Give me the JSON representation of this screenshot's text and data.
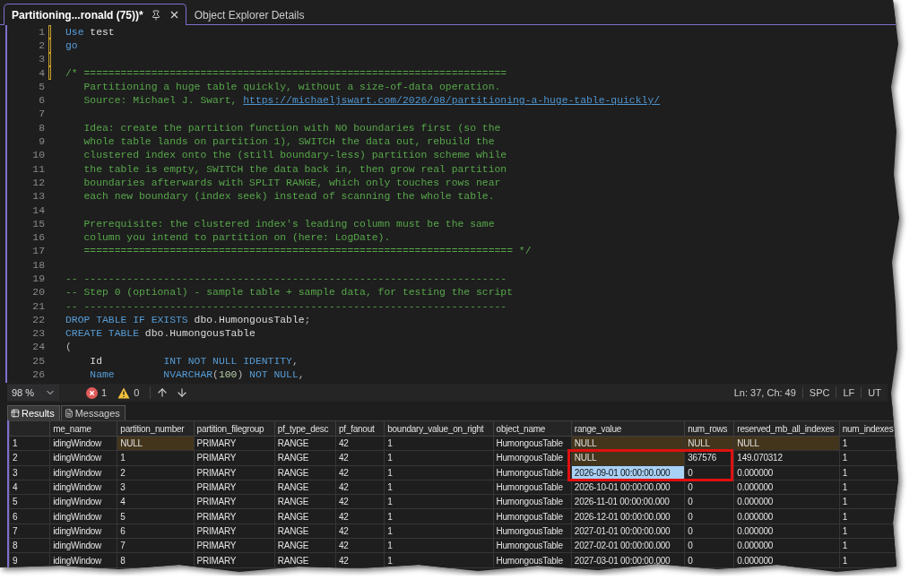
{
  "tabs": [
    {
      "label": "Partitioning...ronald (75))*",
      "selected": true
    },
    {
      "label": "Object Explorer Details",
      "selected": false
    }
  ],
  "editor": {
    "lines": [
      {
        "number": "1",
        "changed": true,
        "tokens": [
          {
            "kind": "keyword",
            "text": "Use"
          },
          {
            "kind": "plain",
            "text": " test"
          }
        ]
      },
      {
        "number": "2",
        "changed": true,
        "tokens": [
          {
            "kind": "keyword",
            "text": "go"
          }
        ]
      },
      {
        "number": "3",
        "changed": true
      },
      {
        "number": "4",
        "changed": true,
        "tokens": [
          {
            "kind": "comment",
            "text": "/* ====================================================================="
          }
        ]
      },
      {
        "number": "5",
        "changed": false,
        "tokens": [
          {
            "kind": "comment",
            "text": "   Partitioning a huge table quickly, without a size-of-data operation."
          }
        ]
      },
      {
        "number": "6",
        "changed": false,
        "tokens": [
          {
            "kind": "comment",
            "text": "   Source: Michael J. Swart, "
          },
          {
            "kind": "link",
            "text": "https://michaeljswart.com/2026/08/partitioning-a-huge-table-quickly/"
          }
        ]
      },
      {
        "number": "7",
        "changed": false
      },
      {
        "number": "8",
        "changed": false,
        "tokens": [
          {
            "kind": "comment",
            "text": "   Idea: create the partition function with NO boundaries first (so the"
          }
        ]
      },
      {
        "number": "9",
        "changed": false,
        "tokens": [
          {
            "kind": "comment",
            "text": "   whole table lands on partition 1), SWITCH the data out, rebuild the"
          }
        ]
      },
      {
        "number": "10",
        "changed": false,
        "tokens": [
          {
            "kind": "comment",
            "text": "   clustered index onto the (still boundary-less) partition scheme while"
          }
        ]
      },
      {
        "number": "11",
        "changed": false,
        "tokens": [
          {
            "kind": "comment",
            "text": "   the table is empty, SWITCH the data back in, then grow real partition"
          }
        ]
      },
      {
        "number": "12",
        "changed": false,
        "tokens": [
          {
            "kind": "comment",
            "text": "   boundaries afterwards with SPLIT RANGE, which only touches rows near"
          }
        ]
      },
      {
        "number": "13",
        "changed": false,
        "tokens": [
          {
            "kind": "comment",
            "text": "   each new boundary (index seek) instead of scanning the whole table."
          }
        ]
      },
      {
        "number": "14",
        "changed": false
      },
      {
        "number": "15",
        "changed": false,
        "tokens": [
          {
            "kind": "comment",
            "text": "   Prerequisite: the clustered index's leading column must be the same"
          }
        ]
      },
      {
        "number": "16",
        "changed": false,
        "tokens": [
          {
            "kind": "comment",
            "text": "   column you intend to partition on (here: LogDate)."
          }
        ]
      },
      {
        "number": "17",
        "changed": false,
        "tokens": [
          {
            "kind": "comment",
            "text": "   ====================================================================== */"
          }
        ]
      },
      {
        "number": "18",
        "changed": false
      },
      {
        "number": "19",
        "changed": false,
        "tokens": [
          {
            "kind": "comment",
            "text": "-- ---------------------------------------------------------------------"
          }
        ]
      },
      {
        "number": "20",
        "changed": false,
        "tokens": [
          {
            "kind": "comment",
            "text": "-- Step 0 (optional) - sample table + sample data, for testing the script"
          }
        ]
      },
      {
        "number": "21",
        "changed": false,
        "tokens": [
          {
            "kind": "comment",
            "text": "-- ---------------------------------------------------------------------"
          }
        ]
      },
      {
        "number": "22",
        "changed": false,
        "tokens": [
          {
            "kind": "keyword",
            "text": "DROP TABLE IF EXISTS"
          },
          {
            "kind": "plain",
            "text": " dbo"
          },
          {
            "kind": "punct",
            "text": "."
          },
          {
            "kind": "plain",
            "text": "HumongousTable"
          },
          {
            "kind": "punct",
            "text": ";"
          }
        ]
      },
      {
        "number": "23",
        "changed": false,
        "tokens": [
          {
            "kind": "keyword",
            "text": "CREATE TABLE"
          },
          {
            "kind": "plain",
            "text": " dbo"
          },
          {
            "kind": "punct",
            "text": "."
          },
          {
            "kind": "plain",
            "text": "HumongousTable"
          }
        ]
      },
      {
        "number": "24",
        "changed": false,
        "tokens": [
          {
            "kind": "punct",
            "text": "("
          }
        ]
      },
      {
        "number": "25",
        "changed": false,
        "tokens": [
          {
            "kind": "plain",
            "text": "    Id          "
          },
          {
            "kind": "keyword",
            "text": "INT NOT NULL IDENTITY"
          },
          {
            "kind": "punct",
            "text": ","
          }
        ]
      },
      {
        "number": "26",
        "changed": false,
        "tokens": [
          {
            "kind": "keyword",
            "text": "    Name        NVARCHAR"
          },
          {
            "kind": "punct",
            "text": "("
          },
          {
            "kind": "number",
            "text": "100"
          },
          {
            "kind": "punct",
            "text": ")"
          },
          {
            "kind": "keyword",
            "text": " NOT NULL"
          },
          {
            "kind": "punct",
            "text": ","
          }
        ]
      }
    ]
  },
  "status_bar": {
    "zoom": "98 %",
    "errors": "1",
    "warnings": "0",
    "position": "Ln: 37, Ch: 49",
    "indent": "SPC",
    "line_ending": "LF",
    "encoding": "UT"
  },
  "result_tabs": [
    {
      "label": "Results",
      "selected": true
    },
    {
      "label": "Messages",
      "selected": false
    }
  ],
  "results": {
    "columns": [
      "me_name",
      "partition_number",
      "partition_filegroup",
      "pf_type_desc",
      "pf_fanout",
      "boundary_value_on_right",
      "object_name",
      "range_value",
      "num_rows",
      "reserved_mb_all_indexes",
      "num_indexes"
    ],
    "rows": [
      {
        "number": "1",
        "cells": [
          {
            "text": "idingWindow",
            "highlighted": false,
            "selected": false
          },
          {
            "text": "NULL",
            "highlighted": true,
            "selected": false
          },
          {
            "text": "PRIMARY",
            "highlighted": false,
            "selected": false
          },
          {
            "text": "RANGE",
            "highlighted": false,
            "selected": false
          },
          {
            "text": "42",
            "highlighted": false,
            "selected": false
          },
          {
            "text": "1",
            "highlighted": false,
            "selected": false
          },
          {
            "text": "HumongousTable",
            "highlighted": false,
            "selected": false
          },
          {
            "text": "NULL",
            "highlighted": true,
            "selected": false
          },
          {
            "text": "NULL",
            "highlighted": true,
            "selected": false
          },
          {
            "text": "NULL",
            "highlighted": true,
            "selected": false
          },
          {
            "text": "1",
            "highlighted": false,
            "selected": false
          }
        ]
      },
      {
        "number": "2",
        "cells": [
          {
            "text": "idingWindow",
            "highlighted": false,
            "selected": false
          },
          {
            "text": "1",
            "highlighted": false,
            "selected": false
          },
          {
            "text": "PRIMARY",
            "highlighted": false,
            "selected": false
          },
          {
            "text": "RANGE",
            "highlighted": false,
            "selected": false
          },
          {
            "text": "42",
            "highlighted": false,
            "selected": false
          },
          {
            "text": "1",
            "highlighted": false,
            "selected": false
          },
          {
            "text": "HumongousTable",
            "highlighted": false,
            "selected": false
          },
          {
            "text": "NULL",
            "highlighted": true,
            "selected": false
          },
          {
            "text": "367576",
            "highlighted": false,
            "selected": false
          },
          {
            "text": "149.070312",
            "highlighted": false,
            "selected": false
          },
          {
            "text": "1",
            "highlighted": false,
            "selected": false
          }
        ]
      },
      {
        "number": "3",
        "cells": [
          {
            "text": "idingWindow",
            "highlighted": false,
            "selected": false
          },
          {
            "text": "2",
            "highlighted": false,
            "selected": false
          },
          {
            "text": "PRIMARY",
            "highlighted": false,
            "selected": false
          },
          {
            "text": "RANGE",
            "highlighted": false,
            "selected": false
          },
          {
            "text": "42",
            "highlighted": false,
            "selected": false
          },
          {
            "text": "1",
            "highlighted": false,
            "selected": false
          },
          {
            "text": "HumongousTable",
            "highlighted": false,
            "selected": false
          },
          {
            "text": "2026-09-01 00:00:00.000",
            "highlighted": false,
            "selected": true
          },
          {
            "text": "0",
            "highlighted": false,
            "selected": false
          },
          {
            "text": "0.000000",
            "highlighted": false,
            "selected": false
          },
          {
            "text": "1",
            "highlighted": false,
            "selected": false
          }
        ]
      },
      {
        "number": "4",
        "cells": [
          {
            "text": "idingWindow",
            "highlighted": false,
            "selected": false
          },
          {
            "text": "3",
            "highlighted": false,
            "selected": false
          },
          {
            "text": "PRIMARY",
            "highlighted": false,
            "selected": false
          },
          {
            "text": "RANGE",
            "highlighted": false,
            "selected": false
          },
          {
            "text": "42",
            "highlighted": false,
            "selected": false
          },
          {
            "text": "1",
            "highlighted": false,
            "selected": false
          },
          {
            "text": "HumongousTable",
            "highlighted": false,
            "selected": false
          },
          {
            "text": "2026-10-01 00:00:00.000",
            "highlighted": false,
            "selected": false
          },
          {
            "text": "0",
            "highlighted": false,
            "selected": false
          },
          {
            "text": "0.000000",
            "highlighted": false,
            "selected": false
          },
          {
            "text": "1",
            "highlighted": false,
            "selected": false
          }
        ]
      },
      {
        "number": "5",
        "cells": [
          {
            "text": "idingWindow",
            "highlighted": false,
            "selected": false
          },
          {
            "text": "4",
            "highlighted": false,
            "selected": false
          },
          {
            "text": "PRIMARY",
            "highlighted": false,
            "selected": false
          },
          {
            "text": "RANGE",
            "highlighted": false,
            "selected": false
          },
          {
            "text": "42",
            "highlighted": false,
            "selected": false
          },
          {
            "text": "1",
            "highlighted": false,
            "selected": false
          },
          {
            "text": "HumongousTable",
            "highlighted": false,
            "selected": false
          },
          {
            "text": "2026-11-01 00:00:00.000",
            "highlighted": false,
            "selected": false
          },
          {
            "text": "0",
            "highlighted": false,
            "selected": false
          },
          {
            "text": "0.000000",
            "highlighted": false,
            "selected": false
          },
          {
            "text": "1",
            "highlighted": false,
            "selected": false
          }
        ]
      },
      {
        "number": "6",
        "cells": [
          {
            "text": "idingWindow",
            "highlighted": false,
            "selected": false
          },
          {
            "text": "5",
            "highlighted": false,
            "selected": false
          },
          {
            "text": "PRIMARY",
            "highlighted": false,
            "selected": false
          },
          {
            "text": "RANGE",
            "highlighted": false,
            "selected": false
          },
          {
            "text": "42",
            "highlighted": false,
            "selected": false
          },
          {
            "text": "1",
            "highlighted": false,
            "selected": false
          },
          {
            "text": "HumongousTable",
            "highlighted": false,
            "selected": false
          },
          {
            "text": "2026-12-01 00:00:00.000",
            "highlighted": false,
            "selected": false
          },
          {
            "text": "0",
            "highlighted": false,
            "selected": false
          },
          {
            "text": "0.000000",
            "highlighted": false,
            "selected": false
          },
          {
            "text": "1",
            "highlighted": false,
            "selected": false
          }
        ]
      },
      {
        "number": "7",
        "cells": [
          {
            "text": "idingWindow",
            "highlighted": false,
            "selected": false
          },
          {
            "text": "6",
            "highlighted": false,
            "selected": false
          },
          {
            "text": "PRIMARY",
            "highlighted": false,
            "selected": false
          },
          {
            "text": "RANGE",
            "highlighted": false,
            "selected": false
          },
          {
            "text": "42",
            "highlighted": false,
            "selected": false
          },
          {
            "text": "1",
            "highlighted": false,
            "selected": false
          },
          {
            "text": "HumongousTable",
            "highlighted": false,
            "selected": false
          },
          {
            "text": "2027-01-01 00:00:00.000",
            "highlighted": false,
            "selected": false
          },
          {
            "text": "0",
            "highlighted": false,
            "selected": false
          },
          {
            "text": "0.000000",
            "highlighted": false,
            "selected": false
          },
          {
            "text": "1",
            "highlighted": false,
            "selected": false
          }
        ]
      },
      {
        "number": "8",
        "cells": [
          {
            "text": "idingWindow",
            "highlighted": false,
            "selected": false
          },
          {
            "text": "7",
            "highlighted": false,
            "selected": false
          },
          {
            "text": "PRIMARY",
            "highlighted": false,
            "selected": false
          },
          {
            "text": "RANGE",
            "highlighted": false,
            "selected": false
          },
          {
            "text": "42",
            "highlighted": false,
            "selected": false
          },
          {
            "text": "1",
            "highlighted": false,
            "selected": false
          },
          {
            "text": "HumongousTable",
            "highlighted": false,
            "selected": false
          },
          {
            "text": "2027-02-01 00:00:00.000",
            "highlighted": false,
            "selected": false
          },
          {
            "text": "0",
            "highlighted": false,
            "selected": false
          },
          {
            "text": "0.000000",
            "highlighted": false,
            "selected": false
          },
          {
            "text": "1",
            "highlighted": false,
            "selected": false
          }
        ]
      },
      {
        "number": "9",
        "cells": [
          {
            "text": "idingWindow",
            "highlighted": false,
            "selected": false
          },
          {
            "text": "8",
            "highlighted": false,
            "selected": false
          },
          {
            "text": "PRIMARY",
            "highlighted": false,
            "selected": false
          },
          {
            "text": "RANGE",
            "highlighted": false,
            "selected": false
          },
          {
            "text": "42",
            "highlighted": false,
            "selected": false
          },
          {
            "text": "1",
            "highlighted": false,
            "selected": false
          },
          {
            "text": "HumongousTable",
            "highlighted": false,
            "selected": false
          },
          {
            "text": "2027-03-01 00:00:00.000",
            "highlighted": false,
            "selected": false
          },
          {
            "text": "0",
            "highlighted": false,
            "selected": false
          },
          {
            "text": "0.000000",
            "highlighted": false,
            "selected": false
          },
          {
            "text": "1",
            "highlighted": false,
            "selected": false
          }
        ]
      }
    ]
  }
}
